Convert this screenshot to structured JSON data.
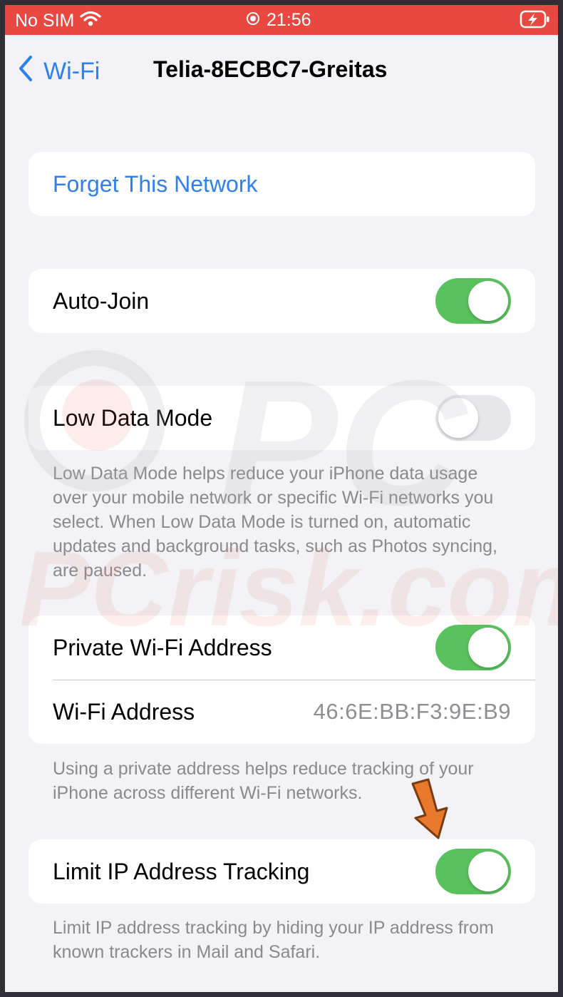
{
  "status_bar": {
    "carrier": "No SIM",
    "time": "21:56",
    "wifi_icon": "wifi-icon",
    "location_icon": "location-icon",
    "battery_icon": "battery-charging-icon"
  },
  "nav": {
    "back_label": "Wi-Fi",
    "title": "Telia-8ECBC7-Greitas"
  },
  "forget": {
    "label": "Forget This Network"
  },
  "auto_join": {
    "label": "Auto-Join",
    "enabled": true
  },
  "low_data": {
    "label": "Low Data Mode",
    "enabled": false,
    "footnote": "Low Data Mode helps reduce your iPhone data usage over your mobile network or specific Wi-Fi networks you select. When Low Data Mode is turned on, automatic updates and background tasks, such as Photos syncing, are paused."
  },
  "private_address": {
    "label": "Private Wi-Fi Address",
    "enabled": true,
    "address_label": "Wi-Fi Address",
    "address_value": "46:6E:BB:F3:9E:B9",
    "footnote": "Using a private address helps reduce tracking of your iPhone across different Wi-Fi networks."
  },
  "limit_ip": {
    "label": "Limit IP Address Tracking",
    "enabled": true,
    "footnote": "Limit IP address tracking by hiding your IP address from known trackers in Mail and Safari."
  },
  "watermark_text": "PCrisk.com",
  "colors": {
    "status_bar": "#e8483f",
    "accent_blue": "#2f80ed",
    "toggle_on": "#5ac15f",
    "toggle_off": "#e6e6eb",
    "arrow": "#e8782a"
  }
}
